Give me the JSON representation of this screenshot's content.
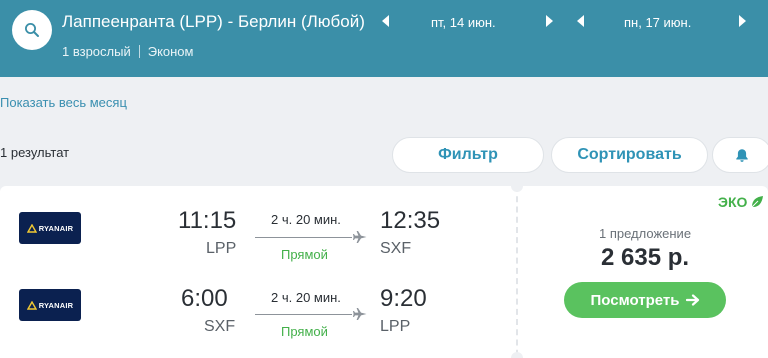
{
  "header": {
    "route": "Лаппеенранта (LPP) - Берлин (Любой)",
    "passengers": "1 взрослый",
    "cabin": "Эконом",
    "depart_date": "пт, 14 июн.",
    "return_date": "пн, 17 июн.",
    "colors": {
      "background": "#3b8fa8",
      "text": "#ffffff"
    },
    "icons": {
      "search": "search-icon",
      "prev": "caret-left-icon",
      "next": "caret-right-icon"
    }
  },
  "month_link": "Показать весь месяц",
  "results_count": "1 результат",
  "toolbar": {
    "filter_label": "Фильтр",
    "sort_label": "Сортировать",
    "alert_icon": "bell-icon"
  },
  "result": {
    "eco_badge": "ЭКО",
    "eco_icon": "leaf-icon",
    "offers": "1 предложение",
    "price": "2 635 р.",
    "view_label": "Посмотреть",
    "view_icon": "arrow-right-icon",
    "segments": [
      {
        "airline": "RYANAIR",
        "dep_time": "11:15",
        "dep_code": "LPP",
        "duration": "2 ч. 20 мин.",
        "stops": "Прямой",
        "arr_time": "12:35",
        "arr_code": "SXF"
      },
      {
        "airline": "RYANAIR",
        "dep_time": "6:00",
        "dep_code": "SXF",
        "duration": "2 ч. 20 мин.",
        "stops": "Прямой",
        "arr_time": "9:20",
        "arr_code": "LPP"
      }
    ],
    "colors": {
      "accent": "#2f93b6",
      "green": "#5ac25f",
      "direct": "#43b04a",
      "logo_bg": "#0b2150"
    }
  }
}
